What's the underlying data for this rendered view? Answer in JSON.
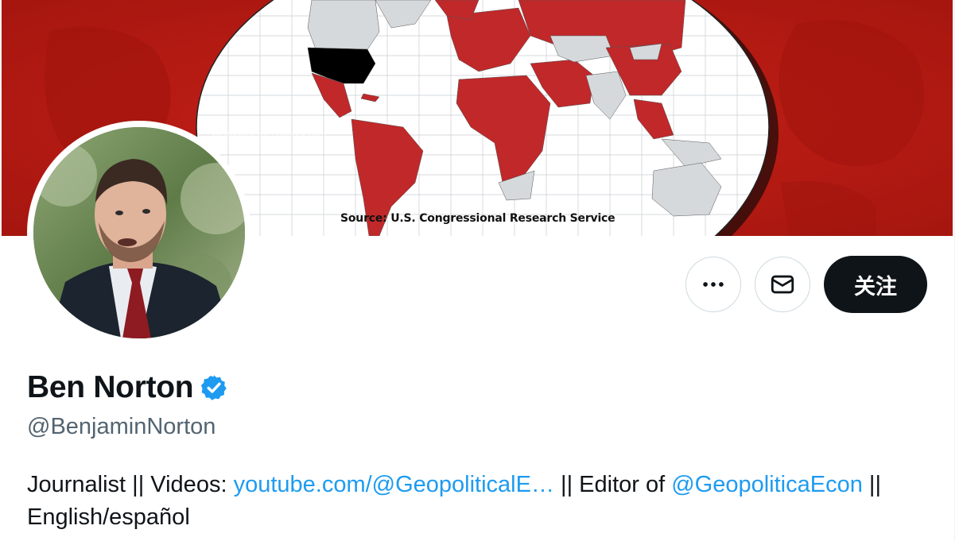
{
  "banner": {
    "source_caption": "Source: U.S. Congressional Research Service",
    "watermark": "GeopoliticalEconomy.com",
    "colors": {
      "background": "#b71a12",
      "highlight_countries": "#c0282a",
      "other_countries": "#d5d9dc",
      "usa": "#000000"
    }
  },
  "profile": {
    "avatar_alt": "Ben Norton profile photo",
    "name": "Ben Norton",
    "verified": true,
    "handle": "@BenjaminNorton"
  },
  "actions": {
    "more_icon": "more-horizontal-icon",
    "message_icon": "envelope-icon",
    "follow_label": "关注"
  },
  "bio": {
    "part1": "Journalist || Videos: ",
    "link1": "youtube.com/@GeopoliticalE…",
    "part2": " || Editor of ",
    "link2": "@GeopoliticaEcon",
    "part3": " || English/español"
  },
  "colors": {
    "accent": "#1d9bf0",
    "text": "#0f1419",
    "muted": "#536471",
    "verified_badge": "#1d9bf0"
  }
}
